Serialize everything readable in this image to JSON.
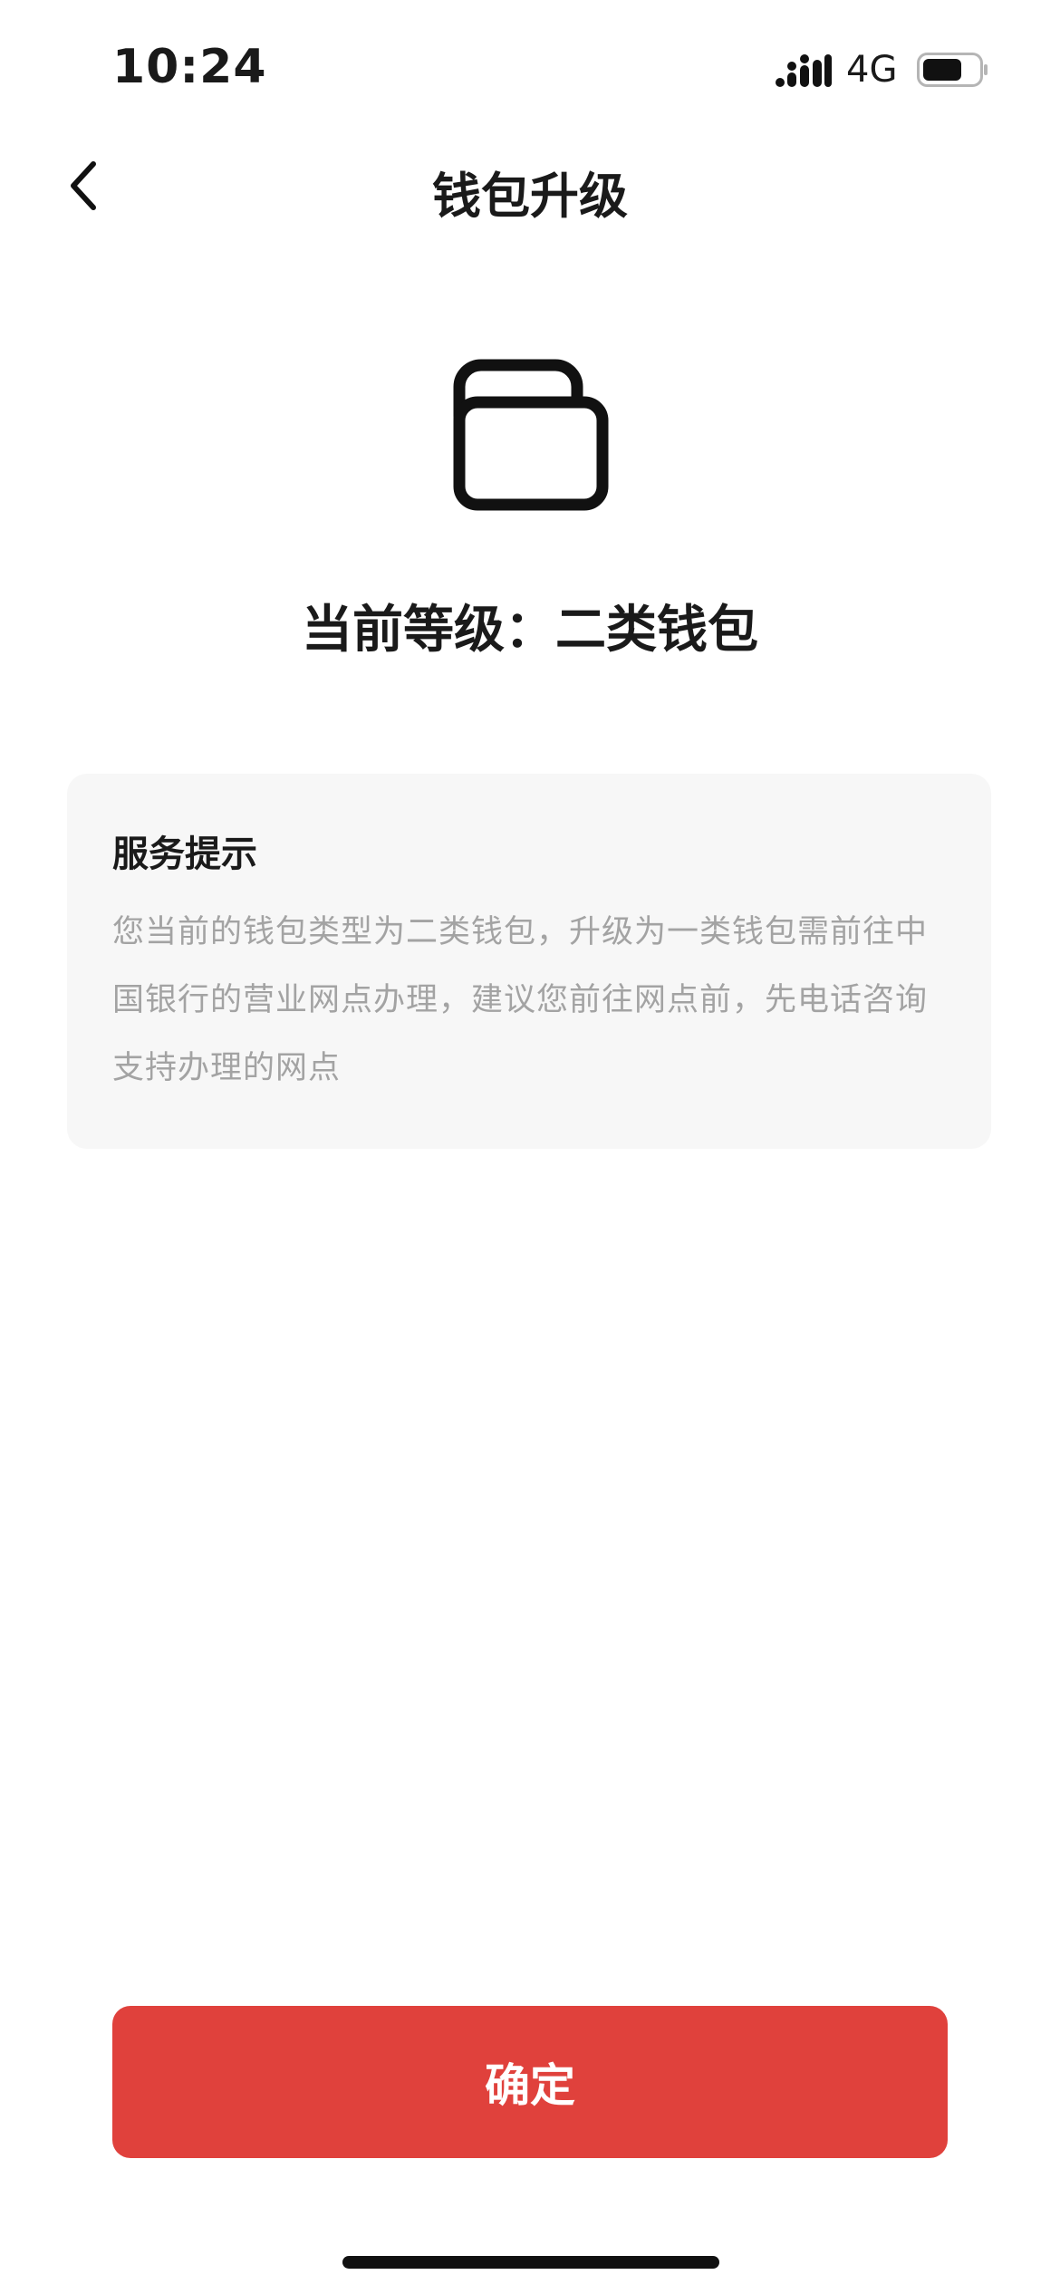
{
  "status_bar": {
    "time": "10:24",
    "network": "4G",
    "signal_icon": "cellular-signal-icon",
    "battery_icon": "battery-icon"
  },
  "nav": {
    "title": "钱包升级",
    "back_icon": "chevron-left-icon"
  },
  "wallet": {
    "icon": "wallet-icon",
    "level_text": "当前等级：二类钱包"
  },
  "tip": {
    "title": "服务提示",
    "body": "您当前的钱包类型为二类钱包，升级为一类钱包需前往中国银行的营业网点办理，建议您前往网点前，先电话咨询支持办理的网点"
  },
  "confirm": {
    "label": "确定"
  },
  "colors": {
    "accent": "#e0413c",
    "card_background": "#f7f7f7",
    "muted_text": "#a3a3a3"
  }
}
